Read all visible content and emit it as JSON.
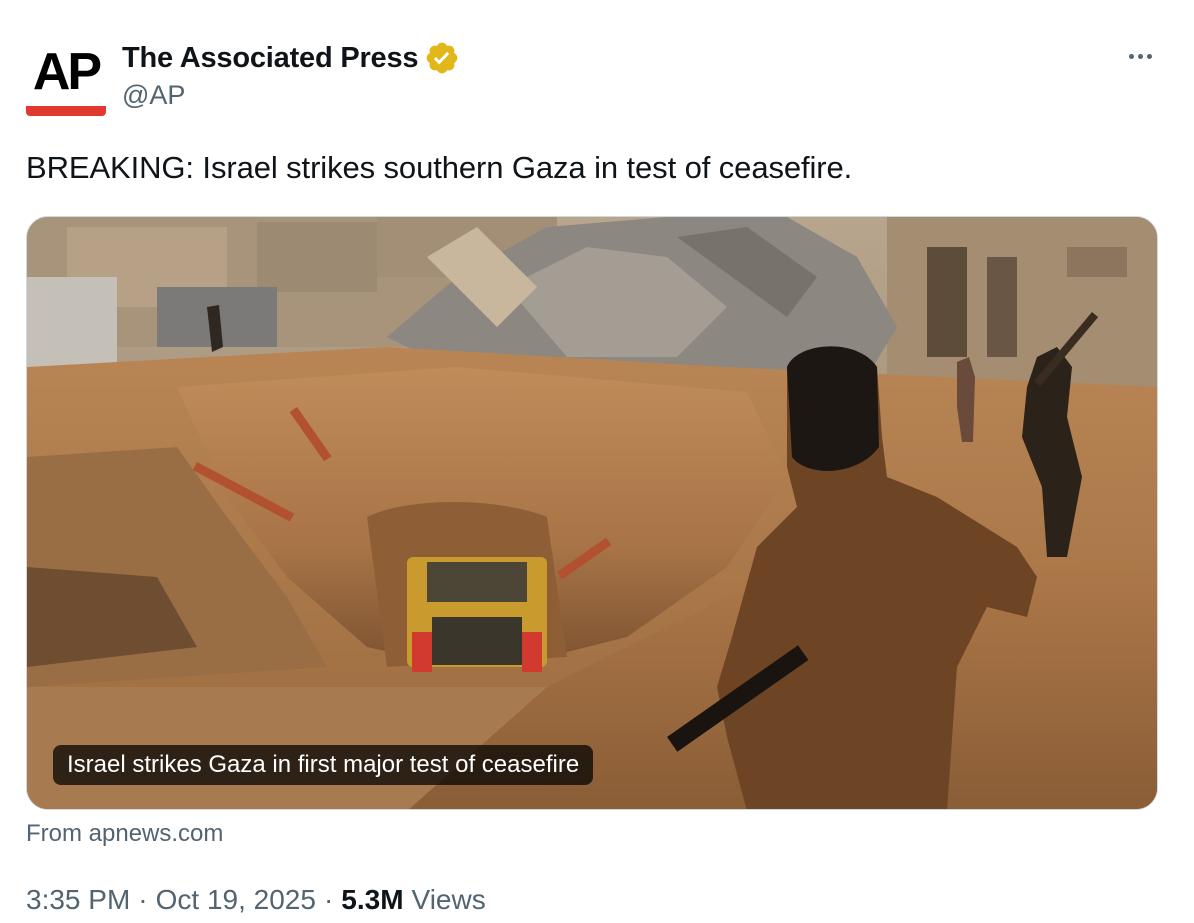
{
  "author": {
    "avatar_text": "AP",
    "display_name": "The Associated Press",
    "handle": "@AP",
    "verified_badge_color": "#E2B719",
    "avatar_bar_color": "#E03A2F"
  },
  "menu": {
    "icon": "more-horizontal-icon"
  },
  "tweet": {
    "text": "BREAKING: Israel strikes southern Gaza in test of ceasefire."
  },
  "card": {
    "caption": "Israel strikes Gaza in first major test of ceasefire",
    "source": "From apnews.com"
  },
  "meta": {
    "time": "3:35 PM",
    "date": "Oct 19, 2025",
    "separator": "·",
    "views_count": "5.3M",
    "views_label": "Views"
  }
}
